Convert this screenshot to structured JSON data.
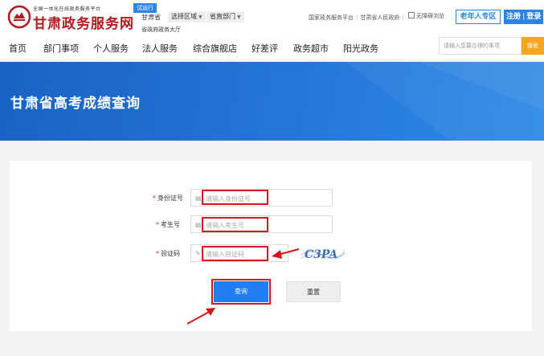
{
  "header": {
    "brand_small": "全国一体化在线政务服务平台",
    "brand_name": "甘肃政务服务网",
    "trial_badge": "试运行",
    "region": "甘肃省",
    "select_region": "选择区域",
    "select_dept": "省直部门",
    "hall": "省政府政务大厅",
    "link_national": "国家政务服务平台",
    "link_province": "甘肃省人民政府",
    "accessibility": "无障碍浏览",
    "elder_zone": "老年人专区",
    "register": "注册",
    "login": "登录"
  },
  "nav": {
    "items": [
      "首页",
      "部门事项",
      "个人服务",
      "法人服务",
      "综合旗舰店",
      "好差评",
      "政务超市",
      "阳光政务"
    ],
    "search_placeholder": "请输入您要办理的事项",
    "search_button": "搜索"
  },
  "banner": {
    "title": "甘肃省高考成绩查询"
  },
  "form": {
    "id_label": "身份证号",
    "id_placeholder": "请输入身份证号",
    "exam_label": "考生号",
    "exam_placeholder": "请输入考生号",
    "code_label": "验证码",
    "code_placeholder": "请输入验证码",
    "captcha_text": "C3PA",
    "query_button": "查询",
    "reset_button": "重置"
  },
  "colors": {
    "brand_red": "#b4191f",
    "primary_blue": "#1e7ef2",
    "highlight_red": "#d7151c",
    "search_orange": "#f6a623"
  }
}
